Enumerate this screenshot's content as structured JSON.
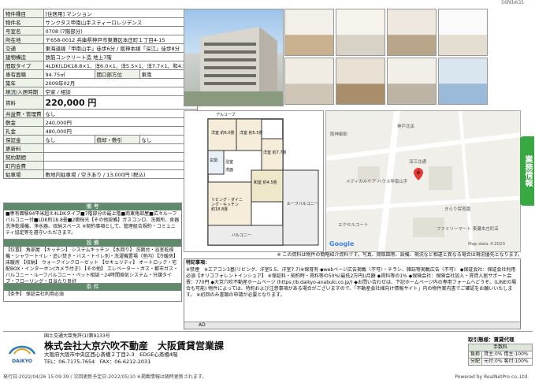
{
  "doc_id": "56f6b635",
  "spec": [
    {
      "label": "物件種目",
      "value": "[住居用] マンション"
    },
    {
      "label": "物件名",
      "value": "サンクタス甲南山手スティーロレジデンス"
    },
    {
      "label": "号室名",
      "value": "0708 (7階部分)"
    },
    {
      "label": "所在地",
      "value": "〒658-0012 兵庫県神戸市東灘区本庄町１丁目4-15"
    },
    {
      "label": "交通",
      "value": "東海道線「甲南山手」徒歩6分 / 阪神本線「深江」徒歩8分"
    },
    {
      "label": "建物構造",
      "value": "鉄筋コンクリート造 地上7階"
    },
    {
      "label": "間取タイプ",
      "value": "4LDK(LDK18.8×1、洋6.0×1、洋5.5×1、洋7.7×1、和4.5×1)"
    },
    {
      "label": "専有面積",
      "value": "94.75㎡"
    },
    {
      "label": "築年",
      "value": "2009年02月"
    },
    {
      "label": "現況/入居時期",
      "value": "空家 / 相談"
    },
    {
      "label": "賃料",
      "value": "220,000 円"
    },
    {
      "label": "共益費・管理費",
      "value": "なし"
    },
    {
      "label": "敷金",
      "value": "240,000円"
    },
    {
      "label": "礼金",
      "value": "480,000円"
    },
    {
      "label": "保証金",
      "value": "なし"
    },
    {
      "label": "更新料",
      "value": ""
    },
    {
      "label": "契約期間",
      "value": ""
    },
    {
      "label": "町内会費",
      "value": ""
    },
    {
      "label": "駐車場",
      "value": "敷地内駐車場 / 空きあり / 13,000円 (税込)"
    }
  ],
  "spec_extra": {
    "opening_label": "開口部方位",
    "opening_value": "東南",
    "deposit_label": "償却・敷引",
    "deposit_value": "なし"
  },
  "remarks": {
    "title": "備 考",
    "text": "■専有面積94平米超え4LDKタイプ■7階部分の最上階■南東角部屋■広々ルーフバルコニー付■LDK約18.8畳■2面採光【その他設備】ガスコンロ、洗面所、食器洗浄乾燥機、浄水器、収納スペース ※契約事項として、管理組合規約・コミュニティ協定等を遵守いただきます。"
  },
  "equipment": {
    "title": "設 備",
    "text": "【位置】 角部屋 【キッチン】 システムキッチン 【水回り】 洗面台・浴室乾燥機・シャワートイレ・追い焚き・バス・トイレ別・洗濯機置場（室内）【冷暖房】 床暖房 【収納】 ウォークインクローゼット 【セキュリティ】 オートロック・宅配BOX・インターホン(カメラ付き) 【その他】 エレベーター・ガス・都市ガス・バルコニー・ルーフバルコニー・ペット相談・24時間換気システム・分譲タイプ・フローリング・日当たり良好"
  },
  "conditions": {
    "title": "条 件",
    "text": "【条件】 保証会社利用必須"
  },
  "info_box": {
    "heading": "特記事項：",
    "text": "※禁煙　※エアコン3基(リビング、洋室5.5、洋室7.7)※保育有 ◆webページ広告掲載〈不可〉・チラシ、雑誌等掲載広告〈不可〉 ◆保証会社：保証会社利用必須【オリコフォレントインシュア】 ※保証料・契約時・賃料等の50%(最低2万円)/月額 ◆賃料等の1% ◆保険会社：保険会社加入・賃貸入居サポート会費：770円 ◆大京穴吹不動産ホームページ (https://b.daikyo-anabuki.co.jp/) ◆お問い合わせは、下記ホームページ内の専用フォームへどうぞ。(LINEの場合も可能) 物件によっては、特約および注意事項がある場合がございますので、「不動産会社様向け情報サイト」内の物件案内書でご確認をお願いいたします。 ※初回のみ書類の申請が必要となります。",
    "ad_label": "AD"
  },
  "map": {
    "labels": [
      "阪神御影",
      "神戸北店",
      "メディカルケア ハウス甲南山手",
      "エクセルコート",
      "ファミリーマート 東灘本庄町店",
      "きらり保育園",
      "深江北通",
      "Google",
      "Map data ©2023"
    ],
    "pin_label": "物件"
  },
  "floorplan": {
    "rooms": [
      "洋室 約6.0畳",
      "洋室 約5.5畳",
      "洋室 約7.7畳",
      "和室 約4.5畳",
      "リビング・ダイニング・キッチン 約18.8畳",
      "ルーフバルコニー",
      "バルコニー",
      "アルコーブ",
      "玄関",
      "浴室",
      "洗面"
    ]
  },
  "side_tab": "業務情報",
  "note_under_images": "※ この資料は物件の簡略紹介資料です。写真、間取図等、設備、現況など相違と異なる場合は現況優先となります。",
  "company": {
    "license": "国土交通大臣免許(1)第9133号",
    "name": "株式会社大京穴吹不動産　大阪賃貸営業課",
    "address": "大阪府大阪市中央区西心斎橋２丁目2-3　EDGE心斎橋4階",
    "tel": "TEL：06-7175-7654　FAX：06-6212-2031",
    "logo": "DAIKYO"
  },
  "fee": {
    "header": "取引態様：賃貸代理",
    "sub": "手数料",
    "rows": [
      {
        "label": "負担",
        "value": "貸主:0% 借主:100%"
      },
      {
        "label": "分配",
        "value": "元付:0% 客付:100%"
      }
    ]
  },
  "footer": {
    "left": "発行日:2022/04/26 15:09:39 / 次回更新予定日:2022/05/10 ※掲載情報は随時更新されます。",
    "right": "Powered by RealNetPro co.,Ltd."
  }
}
